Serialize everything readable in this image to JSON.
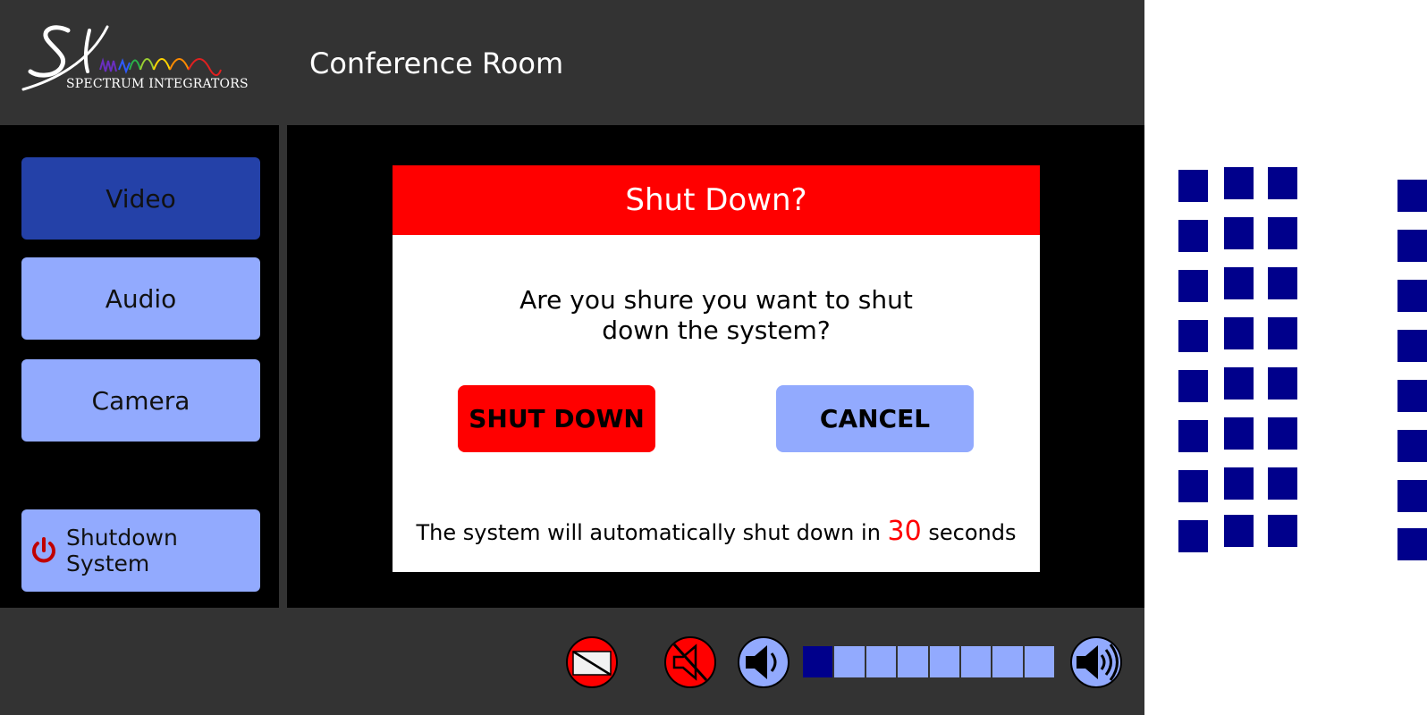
{
  "header": {
    "logo_text": "SPECTRUM INTEGRATORS",
    "room_title": "Conference Room"
  },
  "sidebar": {
    "items": [
      {
        "label": "Video",
        "active": true
      },
      {
        "label": "Audio",
        "active": false
      },
      {
        "label": "Camera",
        "active": false
      }
    ],
    "shutdown_label": "Shutdown System"
  },
  "dialog": {
    "title": "Shut Down?",
    "message_line1": "Are you shure you want to shut",
    "message_line2": "down the system?",
    "shutdown_button": "SHUT DOWN",
    "cancel_button": "CANCEL",
    "countdown_prefix": "The system will automatically shut down in",
    "countdown_value": "30",
    "countdown_suffix": "seconds"
  },
  "footer": {
    "icons": [
      "display-off-icon",
      "mute-icon",
      "volume-down-icon",
      "volume-up-icon"
    ],
    "volume_level_fraction": 0.125,
    "volume_segments": 8
  },
  "colors": {
    "header_bg": "#333333",
    "panel_bg": "#000000",
    "active_nav": "#2441a8",
    "nav": "#92aafe",
    "danger": "#ff0000",
    "volume_on": "#00008b",
    "square_blue": "#00008b"
  }
}
